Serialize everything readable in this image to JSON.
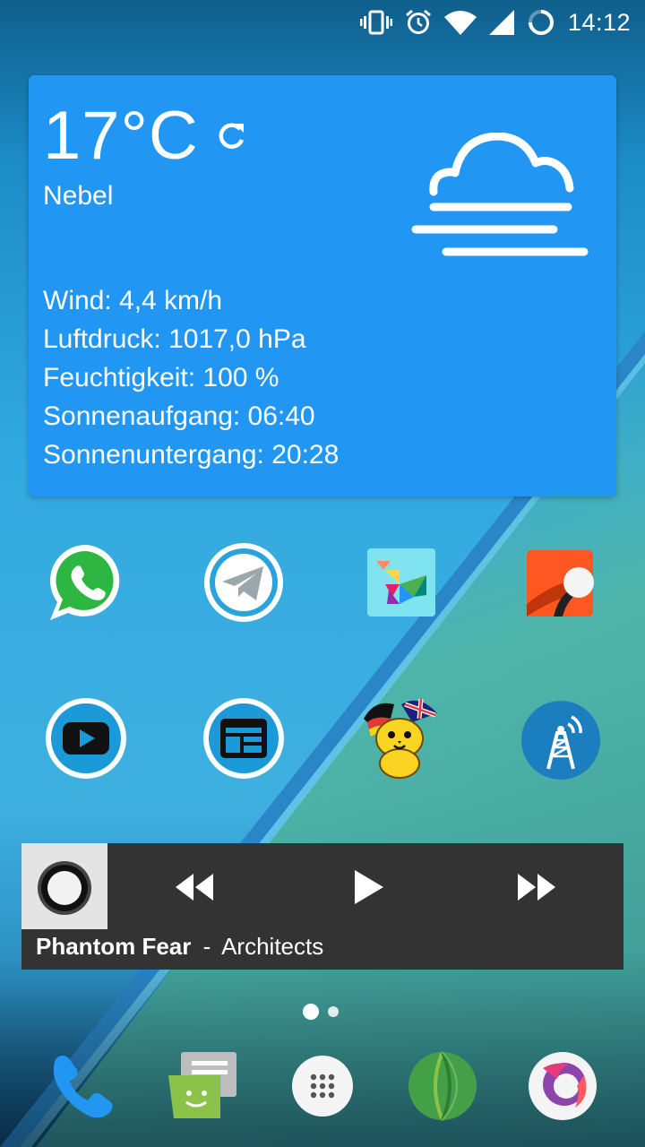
{
  "status_bar": {
    "time": "14:12",
    "icons": [
      "vibrate-icon",
      "alarm-icon",
      "wifi-icon",
      "signal-icon",
      "battery-charging-icon"
    ]
  },
  "weather": {
    "temperature": "17°C",
    "condition": "Nebel",
    "condition_icon": "fog-icon",
    "details": {
      "wind": "Wind: 4,4 km/h",
      "pressure": "Luftdruck: 1017,0 hPa",
      "humidity": "Feuchtigkeit: 100 %",
      "sunrise": "Sonnenaufgang: 06:40",
      "sunset": "Sonnenuntergang: 20:28"
    },
    "color": "#2196f3"
  },
  "apps_row1": [
    "whatsapp-icon",
    "telegram-icon",
    "tangram-app-icon",
    "orange-app-icon"
  ],
  "apps_row2": [
    "youtube-icon",
    "news-app-icon",
    "leo-dictionary-icon",
    "antenna-app-icon"
  ],
  "music": {
    "title": "Phantom Fear",
    "separator": "-",
    "artist": "Architects",
    "controls": [
      "rewind-icon",
      "play-icon",
      "fast-forward-icon"
    ]
  },
  "pager": {
    "current_page": 1,
    "total_pages": 2
  },
  "dock": [
    "phone-icon",
    "messaging-icon",
    "app-drawer-icon",
    "melon-app-icon",
    "firefox-icon"
  ]
}
